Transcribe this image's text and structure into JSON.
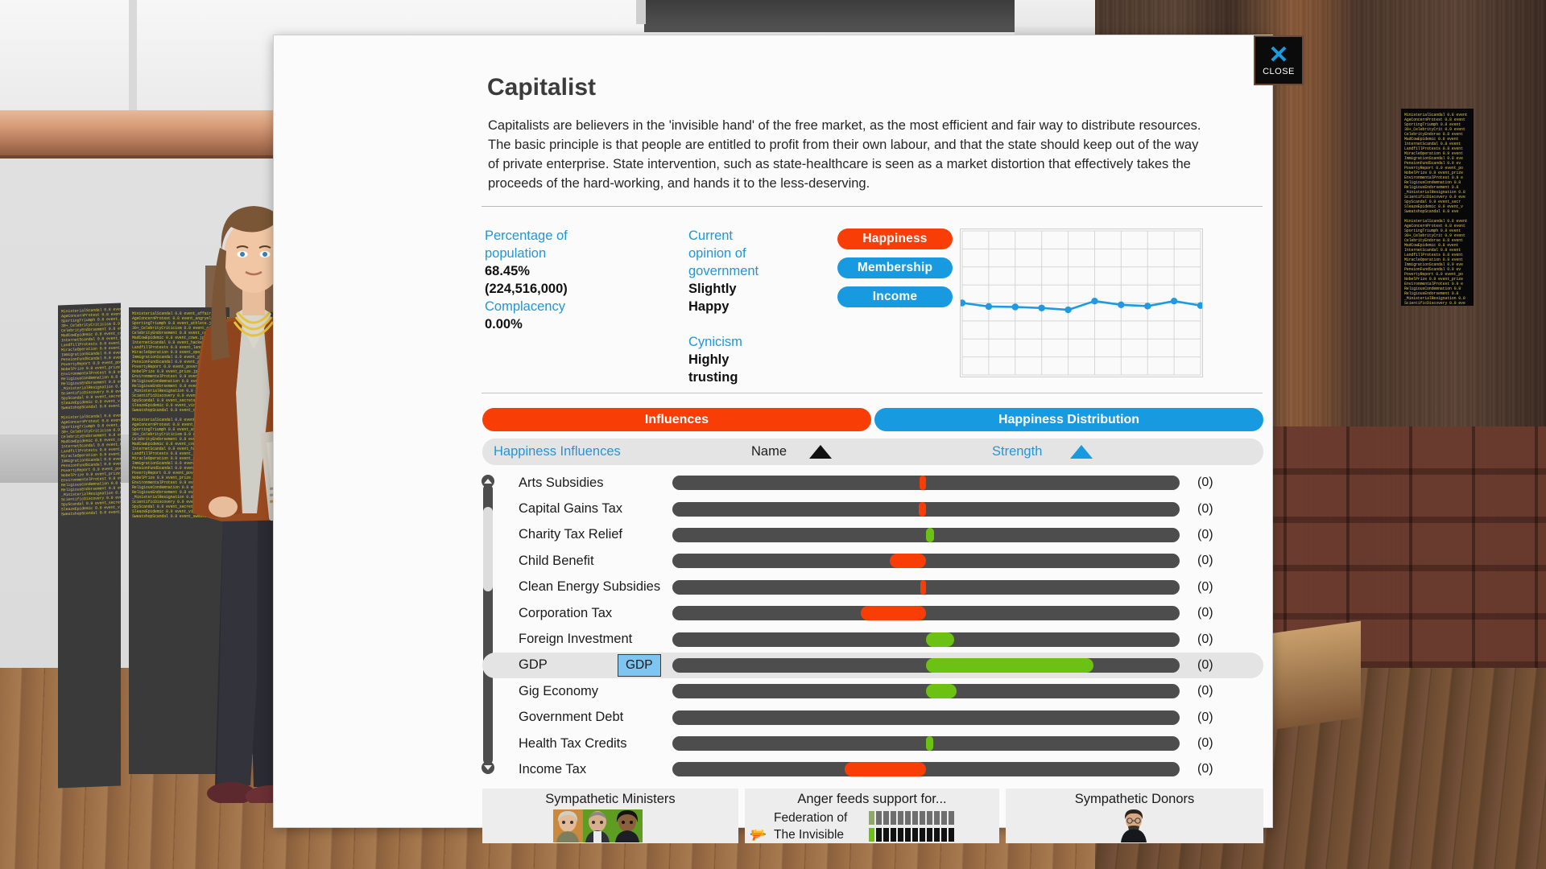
{
  "window": {
    "close_glyph": "✕",
    "close_label": "CLOSE"
  },
  "header": {
    "title": "Capitalist",
    "description": "Capitalists are believers in the 'invisible hand' of the free market, as the most efficient and fair way to distribute resources. The basic principle is that people are entitled to profit from their own labour, and that the state should keep out of the way of private enterprise. State intervention, such as state-healthcare is seen as a market distortion that effectively takes the proceeds of the hard-working, and hands it to the less-deserving."
  },
  "stats": {
    "population_label": "Percentage of population",
    "population_value": "68.45%",
    "population_count": "(224,516,000)",
    "complacency_label": "Complacency",
    "complacency_value": "0.00%",
    "opinion_label": "Current opinion of government",
    "opinion_value": "Slightly Happy",
    "cynicism_label": "Cynicism",
    "cynicism_value": "Highly trusting"
  },
  "mode_buttons": [
    {
      "label": "Happiness",
      "selected": true
    },
    {
      "label": "Membership",
      "selected": false
    },
    {
      "label": "Income",
      "selected": false
    }
  ],
  "tabs": [
    {
      "label": "Influences",
      "active": true
    },
    {
      "label": "Happiness Distribution",
      "active": false
    }
  ],
  "list_header": {
    "group_label": "Happiness Influences",
    "name_label": "Name",
    "strength_label": "Strength",
    "name_sort_icon": "triangle-up-icon",
    "strength_sort_icon": "triangle-up-icon"
  },
  "tooltip": {
    "text": "GDP"
  },
  "influences": [
    {
      "name": "Arts Subsidies",
      "value": "(0)",
      "strength": -0.012,
      "color": "#f93d06",
      "highlight": false
    },
    {
      "name": "Capital Gains Tax",
      "value": "(0)",
      "strength": -0.014,
      "color": "#f93d06",
      "highlight": false
    },
    {
      "name": "Charity Tax Relief",
      "value": "(0)",
      "strength": 0.016,
      "color": "#6cc214",
      "highlight": false
    },
    {
      "name": "Child Benefit",
      "value": "(0)",
      "strength": -0.072,
      "color": "#f93d06",
      "highlight": false
    },
    {
      "name": "Clean Energy Subsidies",
      "value": "(0)",
      "strength": -0.011,
      "color": "#f93d06",
      "highlight": false
    },
    {
      "name": "Corporation Tax",
      "value": "(0)",
      "strength": -0.128,
      "color": "#f93d06",
      "highlight": false
    },
    {
      "name": "Foreign Investment",
      "value": "(0)",
      "strength": 0.056,
      "color": "#6cc214",
      "highlight": false
    },
    {
      "name": "GDP",
      "value": "(0)",
      "strength": 0.33,
      "color": "#6cc214",
      "highlight": true
    },
    {
      "name": "Gig Economy",
      "value": "(0)",
      "strength": 0.06,
      "color": "#6cc214",
      "highlight": false
    },
    {
      "name": "Government Debt",
      "value": "(0)",
      "strength": 0.0,
      "color": "#6cc214",
      "highlight": false
    },
    {
      "name": "Health Tax Credits",
      "value": "(0)",
      "strength": 0.014,
      "color": "#6cc214",
      "highlight": false
    },
    {
      "name": "Income Tax",
      "value": "(0)",
      "strength": -0.16,
      "color": "#f93d06",
      "highlight": false
    }
  ],
  "bottom": {
    "ministers_title": "Sympathetic Ministers",
    "anger_title": "Anger feeds support for...",
    "anger_items": [
      {
        "label": "Federation of",
        "filled": 1,
        "total": 12,
        "style": "muted"
      },
      {
        "label": "The Invisible",
        "filled": 1,
        "total": 12,
        "style": "active"
      }
    ],
    "donors_title": "Sympathetic Donors",
    "gun_icon": "pistol-icon"
  },
  "chart_data": {
    "type": "line",
    "title": "",
    "xlabel": "",
    "ylabel": "",
    "series_name": "Happiness",
    "color": "#1e9ae0",
    "x": [
      0,
      1,
      2,
      3,
      4,
      5,
      6,
      7,
      8,
      9
    ],
    "values": [
      0.5,
      0.475,
      0.472,
      0.465,
      0.452,
      0.513,
      0.487,
      0.478,
      0.513,
      0.482
    ],
    "ylim": [
      0,
      1
    ],
    "grid": true,
    "grid_cols": 9,
    "grid_rows": 8,
    "legend": "none"
  },
  "colors": {
    "accent_orange": "#f93d06",
    "accent_blue": "#189ae0",
    "label_blue": "#2196d8",
    "bar_track": "#4d4d4d",
    "bar_positive": "#6cc214",
    "bar_negative": "#f93d06"
  }
}
